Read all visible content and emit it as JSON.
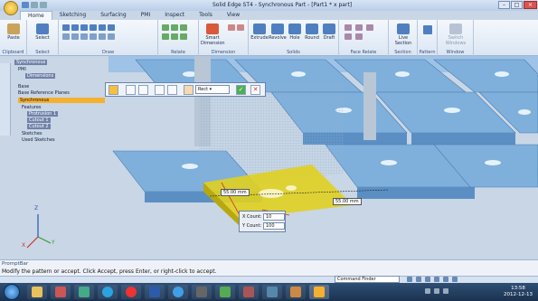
{
  "window": {
    "title": "Solid Edge ST4 - Synchronous Part - [Part1 * х part]"
  },
  "tabs": [
    "Home",
    "Sketching",
    "Surfacing",
    "PMI",
    "Inspect",
    "Tools",
    "View"
  ],
  "ribbon": {
    "groups": [
      "Clipboard",
      "Select",
      "Draw",
      "Relate",
      "Dimension",
      "Solids",
      "Face Relate",
      "Section",
      "Pattern",
      "Window"
    ],
    "buttons": {
      "paste": "Paste",
      "select": "Select",
      "smart_dimension": "Smart Dimension",
      "extrude": "Extrude",
      "revolve": "Revolve",
      "hole": "Hole",
      "round": "Round",
      "draft": "Draft",
      "live_section": "Live Section",
      "switch_windows": "Switch Windows"
    }
  },
  "pathfinder": {
    "items": [
      {
        "label": "Synchronous",
        "style": "dark"
      },
      {
        "label": "PMI",
        "style": "normal"
      },
      {
        "label": "Dimensions",
        "style": "dark"
      },
      {
        "label": "Base",
        "style": "normal"
      },
      {
        "label": "Base Reference Planes",
        "style": "normal"
      },
      {
        "label": "Synchronous",
        "style": "selected"
      },
      {
        "label": "Features",
        "style": "normal"
      },
      {
        "label": "Protrusion 1",
        "style": "dark"
      },
      {
        "label": "Cutout 1",
        "style": "dark"
      },
      {
        "label": "Cutout 2",
        "style": "dark"
      },
      {
        "label": "Sketches",
        "style": "normal"
      },
      {
        "label": "Used Sketches",
        "style": "normal"
      }
    ]
  },
  "command_bar": {
    "dropdown_value": "Rect"
  },
  "dimensions": {
    "dim1": "55.00 mm",
    "dim2": "55.00 mm"
  },
  "count_box": {
    "x_label": "X Count:",
    "x_value": "10",
    "y_label": "Y Count:",
    "y_value": "100"
  },
  "prompt_bar": {
    "title": "PromptBar",
    "message": "Modify the pattern or accept.  Click Accept, press Enter, or right-click to accept."
  },
  "status": {
    "command_finder": "Command Finder"
  },
  "clock": {
    "time": "13:58",
    "date": "2012-12-13"
  },
  "colors": {
    "plate": "#7fb0dc",
    "selection": "#e0d020",
    "accent": "#f5b030"
  }
}
